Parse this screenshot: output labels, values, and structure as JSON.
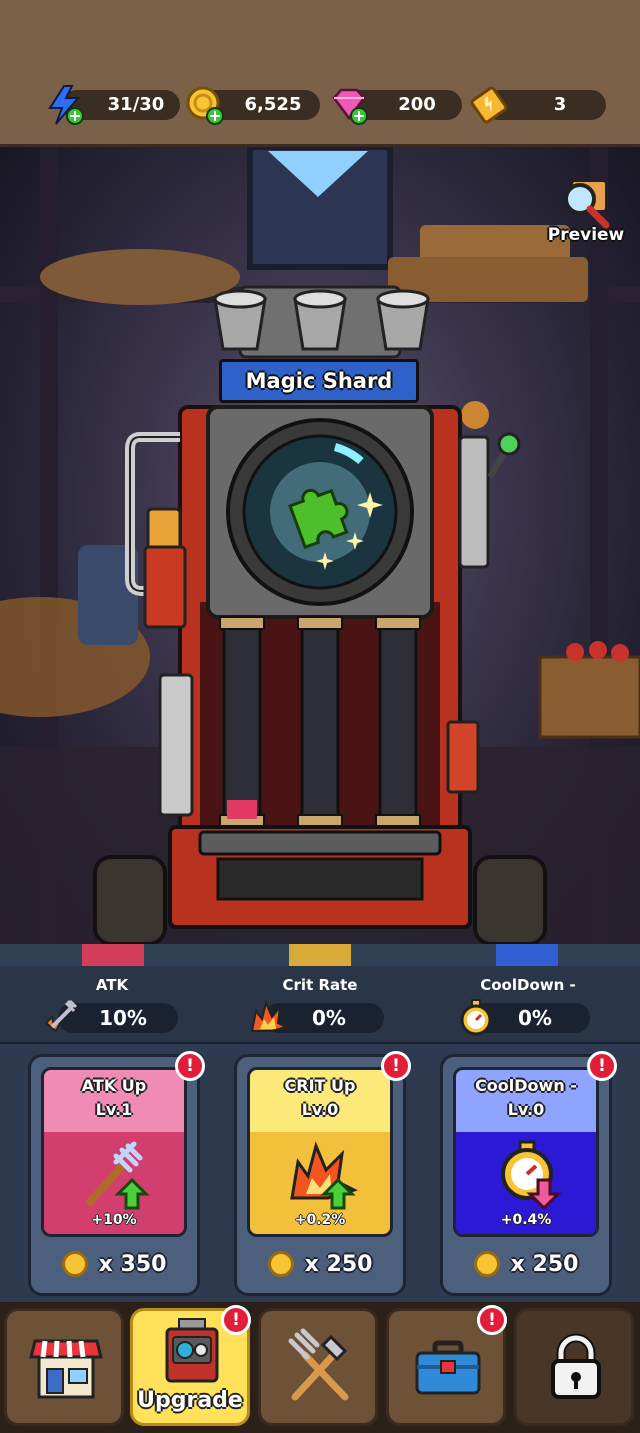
{
  "resources": {
    "energy": {
      "value": "31/30",
      "icon": "lightning-plus-icon"
    },
    "gold": {
      "value": "6,525",
      "icon": "gold-coin-plus-icon"
    },
    "gems": {
      "value": "200",
      "icon": "pink-gem-plus-icon"
    },
    "tickets": {
      "value": "3",
      "icon": "ticket-icon"
    }
  },
  "scene": {
    "preview_label": "Preview",
    "machine_title": "Magic Shard",
    "gauges": [
      {
        "color": "#e23a62",
        "fill": 0.1
      },
      {
        "color": "#e7b53c",
        "fill": 0
      },
      {
        "color": "#3c6fd8",
        "fill": 0
      }
    ]
  },
  "stats": [
    {
      "label": "ATK",
      "value": "10%",
      "icon": "pitchfork-spark-icon"
    },
    {
      "label": "Crit Rate",
      "value": "0%",
      "icon": "explosion-icon"
    },
    {
      "label": "CoolDown -",
      "value": "0%",
      "icon": "stopwatch-icon"
    }
  ],
  "cards": [
    {
      "title": "ATK Up",
      "level": "Lv.1",
      "bonus": "+10%",
      "cost": "x 350",
      "top_color": "#f08cb4",
      "bottom_color": "#d23e6e",
      "icon": "pitchfork-up-arrow-icon",
      "alert": "!"
    },
    {
      "title": "CRIT Up",
      "level": "Lv.0",
      "bonus": "+0.2%",
      "cost": "x 250",
      "top_color": "#fde97a",
      "bottom_color": "#f2c03a",
      "icon": "explosion-up-arrow-icon",
      "alert": "!"
    },
    {
      "title": "CoolDown -",
      "level": "Lv.0",
      "bonus": "+0.4%",
      "cost": "x 250",
      "top_color": "#8ea4ff",
      "bottom_color": "#2c19d6",
      "icon": "stopwatch-down-arrow-icon",
      "alert": "!"
    }
  ],
  "nav": [
    {
      "label": "",
      "icon": "shop-icon",
      "active": false
    },
    {
      "label": "Upgrade",
      "icon": "machine-icon",
      "active": true,
      "alert": "!"
    },
    {
      "label": "",
      "icon": "pitchfork-shovel-icon",
      "active": false
    },
    {
      "label": "",
      "icon": "toolbox-icon",
      "active": false,
      "alert": "!"
    },
    {
      "label": "",
      "icon": "lock-icon",
      "active": false
    }
  ],
  "colors": {
    "gold_coin": "#f7c436",
    "alert_red": "#e11e3a",
    "energy_blue": "#2f6df0",
    "gem_pink": "#f05ab4"
  }
}
